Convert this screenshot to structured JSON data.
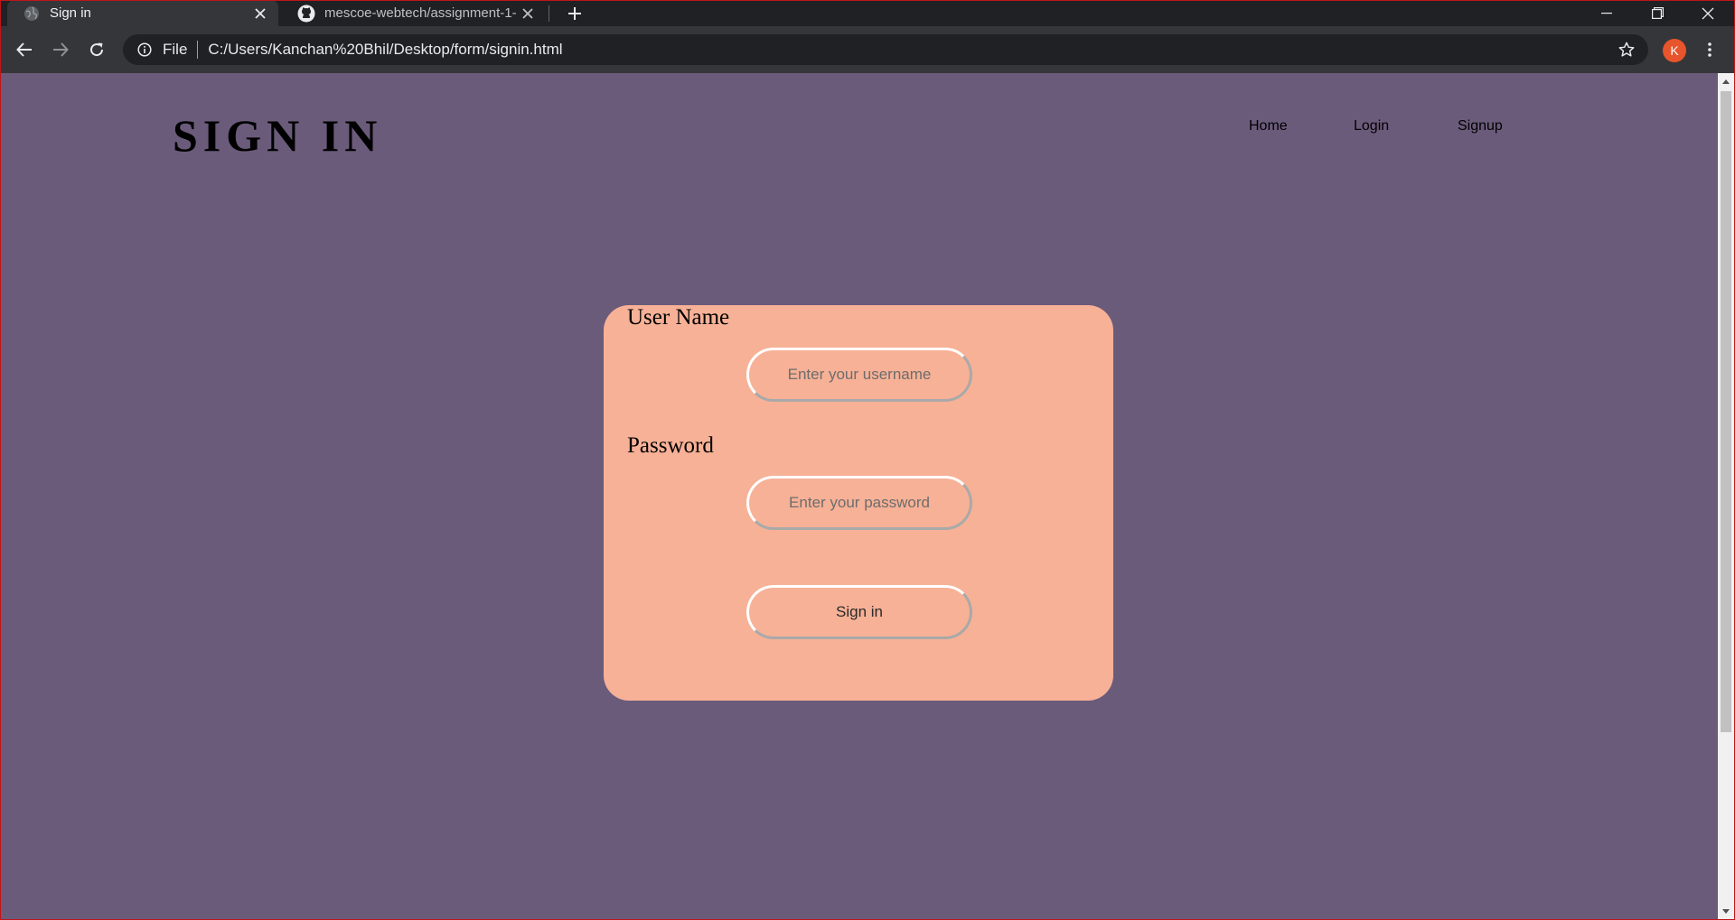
{
  "browser": {
    "tabs": [
      {
        "title": "Sign in",
        "active": true
      },
      {
        "title": "mescoe-webtech/assignment-1-",
        "active": false
      }
    ],
    "omnibox": {
      "scheme": "File",
      "url": "C:/Users/Kanchan%20Bhil/Desktop/form/signin.html"
    },
    "profile_initial": "K"
  },
  "page": {
    "title": "SIGN IN",
    "nav": [
      {
        "label": "Home"
      },
      {
        "label": "Login"
      },
      {
        "label": "Signup"
      }
    ],
    "form": {
      "username_label": "User Name",
      "username_placeholder": "Enter your username",
      "password_label": "Password",
      "password_placeholder": "Enter your password",
      "submit_label": "Sign in"
    }
  },
  "colors": {
    "page_background": "#6b5b7b",
    "card_background": "#f7b196",
    "browser_dark": "#202124",
    "browser_toolbar": "#35363a",
    "avatar": "#e8542b",
    "window_border": "#c0151b"
  }
}
